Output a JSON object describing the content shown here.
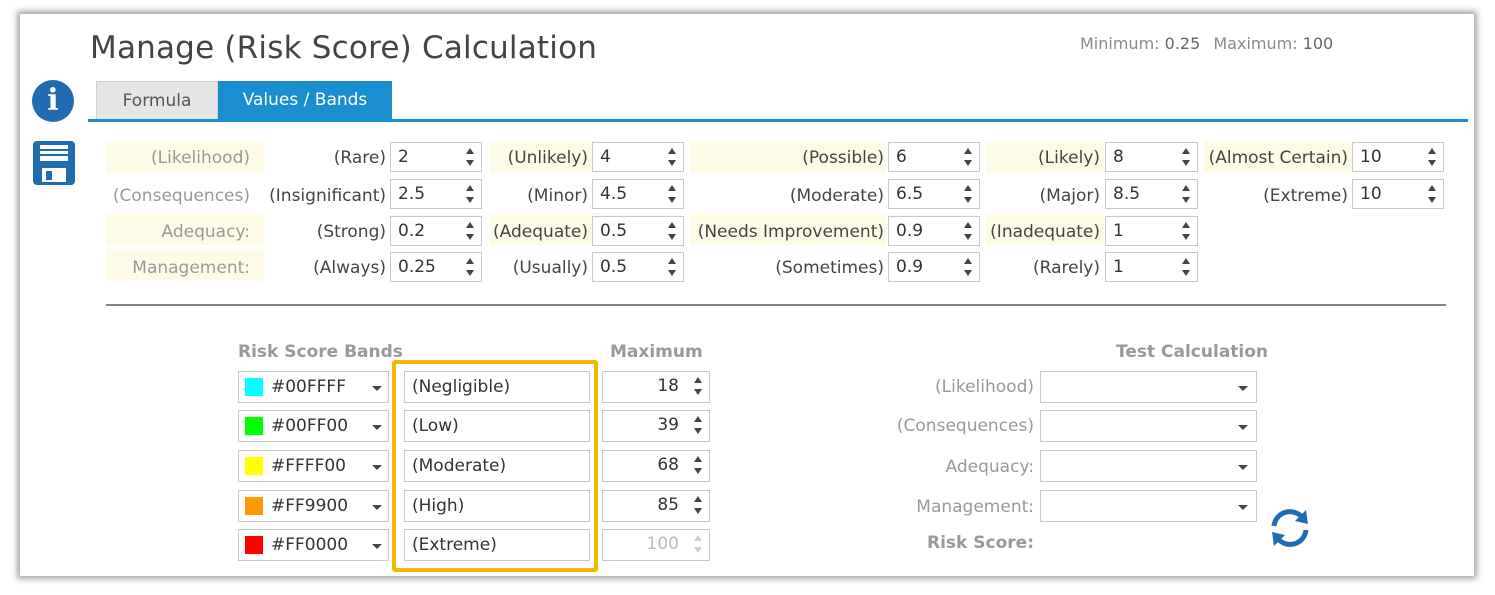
{
  "title": "Manage (Risk Score) Calculation",
  "minmax": {
    "min_label": "Minimum:",
    "min_value": "0.25",
    "max_label": "Maximum:",
    "max_value": "100"
  },
  "tabs": [
    {
      "label": "Formula"
    },
    {
      "label": "Values / Bands"
    }
  ],
  "factors": {
    "likelihood": {
      "label": "(Likelihood)",
      "items": [
        {
          "label": "(Rare)",
          "value": "2"
        },
        {
          "label": "(Unlikely)",
          "value": "4"
        },
        {
          "label": "(Possible)",
          "value": "6"
        },
        {
          "label": "(Likely)",
          "value": "8"
        },
        {
          "label": "(Almost Certain)",
          "value": "10"
        }
      ]
    },
    "consequences": {
      "label": "(Consequences)",
      "items": [
        {
          "label": "(Insignificant)",
          "value": "2.5"
        },
        {
          "label": "(Minor)",
          "value": "4.5"
        },
        {
          "label": "(Moderate)",
          "value": "6.5"
        },
        {
          "label": "(Major)",
          "value": "8.5"
        },
        {
          "label": "(Extreme)",
          "value": "10"
        }
      ]
    },
    "adequacy": {
      "label": "Adequacy:",
      "items": [
        {
          "label": "(Strong)",
          "value": "0.2"
        },
        {
          "label": "(Adequate)",
          "value": "0.5"
        },
        {
          "label": "(Needs Improvement)",
          "value": "0.9"
        },
        {
          "label": "(Inadequate)",
          "value": "1"
        }
      ]
    },
    "management": {
      "label": "Management:",
      "items": [
        {
          "label": "(Always)",
          "value": "0.25"
        },
        {
          "label": "(Usually)",
          "value": "0.5"
        },
        {
          "label": "(Sometimes)",
          "value": "0.9"
        },
        {
          "label": "(Rarely)",
          "value": "1"
        }
      ]
    }
  },
  "bands": {
    "header": "Risk Score Bands",
    "max_header": "Maximum",
    "rows": [
      {
        "color": "#00FFFF",
        "hex": "#00FFFF",
        "name": "(Negligible)",
        "max": "18"
      },
      {
        "color": "#00FF00",
        "hex": "#00FF00",
        "name": "(Low)",
        "max": "39"
      },
      {
        "color": "#FFFF00",
        "hex": "#FFFF00",
        "name": "(Moderate)",
        "max": "68"
      },
      {
        "color": "#FF9900",
        "hex": "#FF9900",
        "name": "(High)",
        "max": "85"
      },
      {
        "color": "#FF0000",
        "hex": "#FF0000",
        "name": "(Extreme)",
        "max": "100"
      }
    ]
  },
  "test": {
    "header": "Test Calculation",
    "likelihood": "(Likelihood)",
    "consequences": "(Consequences)",
    "adequacy": "Adequacy:",
    "management": "Management:",
    "risk_score": "Risk Score:"
  },
  "colors": {
    "accent": "#1b8ed0",
    "highlight": "#f5b800",
    "row_bg": "#fdfbe6"
  },
  "icons": {
    "info": "info-icon",
    "save": "save-icon",
    "refresh": "refresh-icon"
  }
}
